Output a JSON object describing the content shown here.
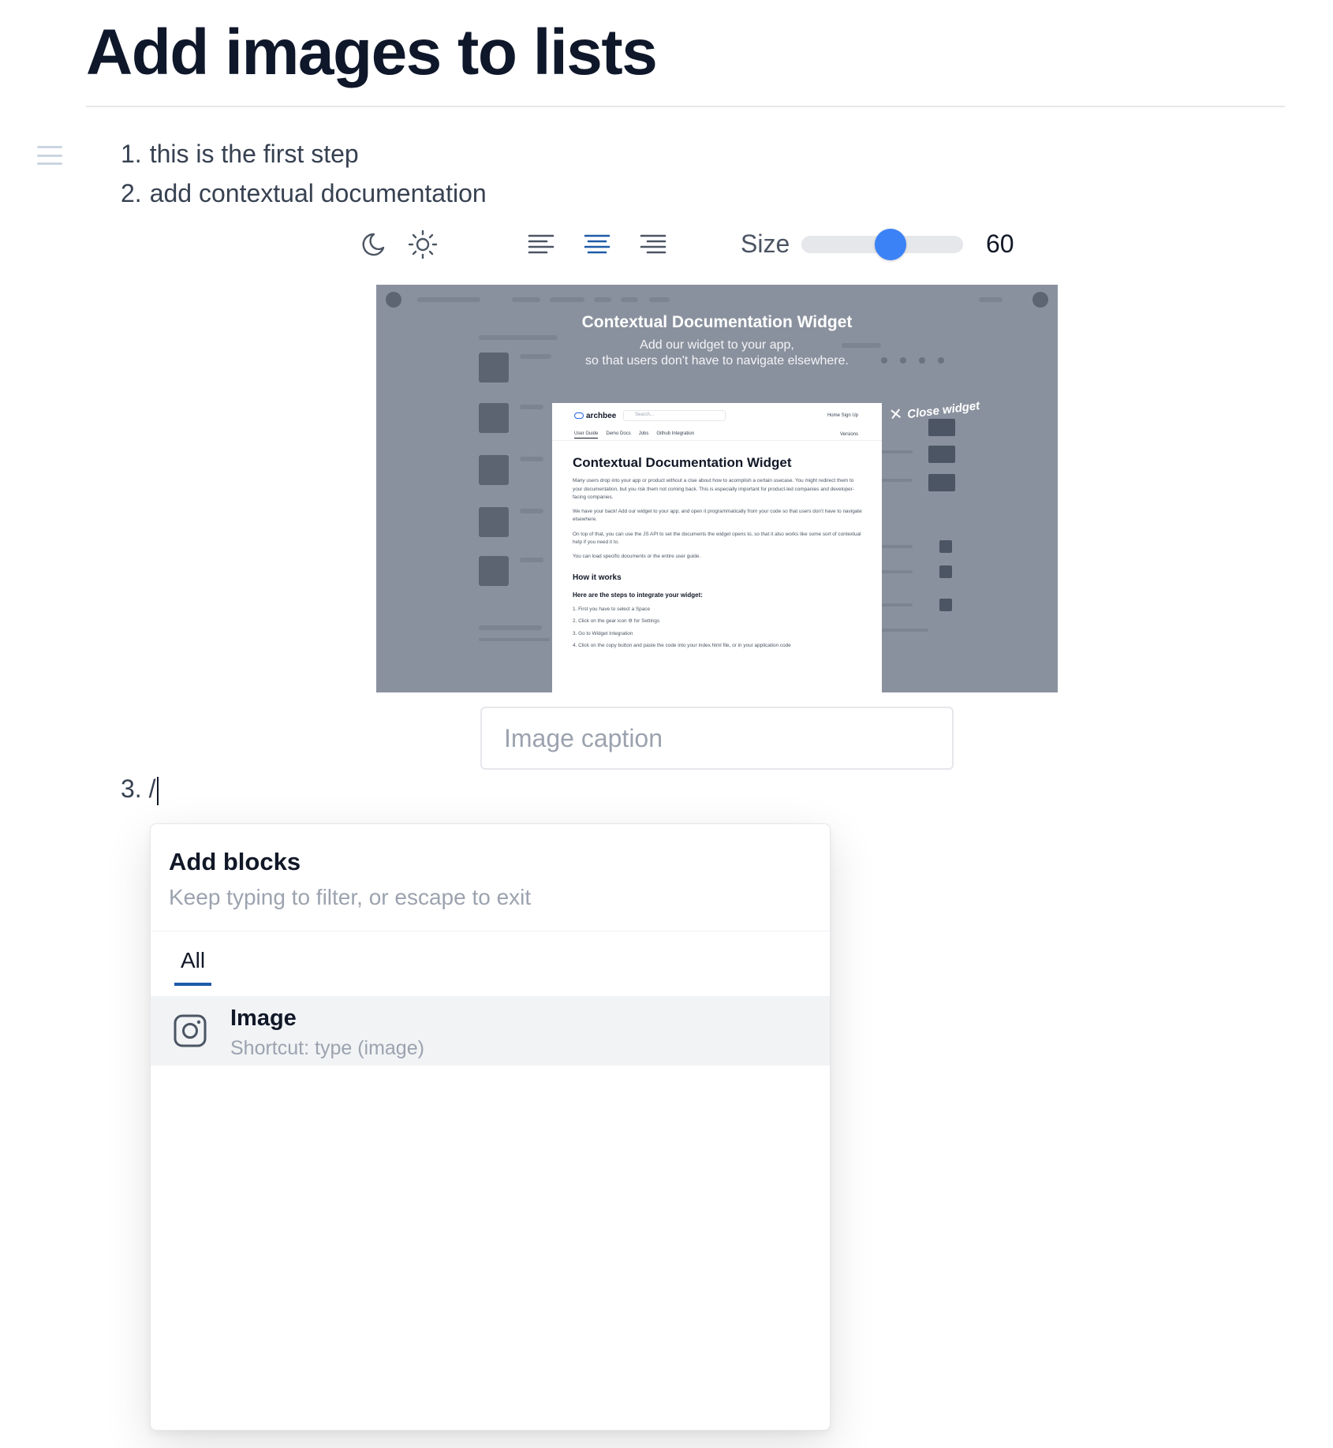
{
  "page": {
    "title": "Add images to lists"
  },
  "list": {
    "items": [
      {
        "number": "1.",
        "text": "this is the first step"
      },
      {
        "number": "2.",
        "text": "add contextual documentation"
      },
      {
        "number": "3.",
        "text": "/"
      }
    ]
  },
  "image_toolbar": {
    "size_label": "Size",
    "size_value": "60",
    "size_fraction": 0.55,
    "accent_color": "#3b82f6",
    "active_align": "center"
  },
  "image": {
    "title": "Contextual Documentation Widget",
    "subtitle_line1": "Add our widget to your app,",
    "subtitle_line2": "so that users don't have to navigate elsewhere.",
    "close_label": "Close widget",
    "widget": {
      "brand": "archbee",
      "search_placeholder": "Search...",
      "nav": "Home  Sign Up",
      "tabs": [
        "User Guide",
        "Demo Docs",
        "Jobs",
        "Github Integration"
      ],
      "versions": "Versions",
      "heading": "Contextual Documentation Widget",
      "para1": "Many users drop into your app or product without a clue about how to acomplish a certain usecase. You might redirect them to your documentation, but you risk them not coming back. This is especially important for product-led companies and developer-facing companies.",
      "para2": "We have your back! Add our widget to your app, and open it programmatically from your code so that users don't have to navigate elsewhere.",
      "para3": "On top of that, you can use the JS API to set the documents the widget opens to, so that it also works like some sort of contextual help if you need it to.",
      "para4": "You can load specific documents or the entire user guide.",
      "how_heading": "How it works",
      "steps_heading": "Here are the steps to integrate your widget:",
      "steps": [
        "1. First you have to select a Space",
        "2. Click on the gear icon ⚙ for Settings",
        "3. Go to Widget Integration",
        "4. Click on the copy button and paste the code into your index.html file, or in your application code"
      ]
    }
  },
  "caption": {
    "placeholder": "Image caption",
    "value": ""
  },
  "block_menu": {
    "title": "Add blocks",
    "hint": "Keep typing to filter, or escape to exit",
    "tab_all": "All",
    "items": [
      {
        "label": "Image",
        "shortcut": "Shortcut: type (image)",
        "icon": "image-icon"
      }
    ]
  }
}
